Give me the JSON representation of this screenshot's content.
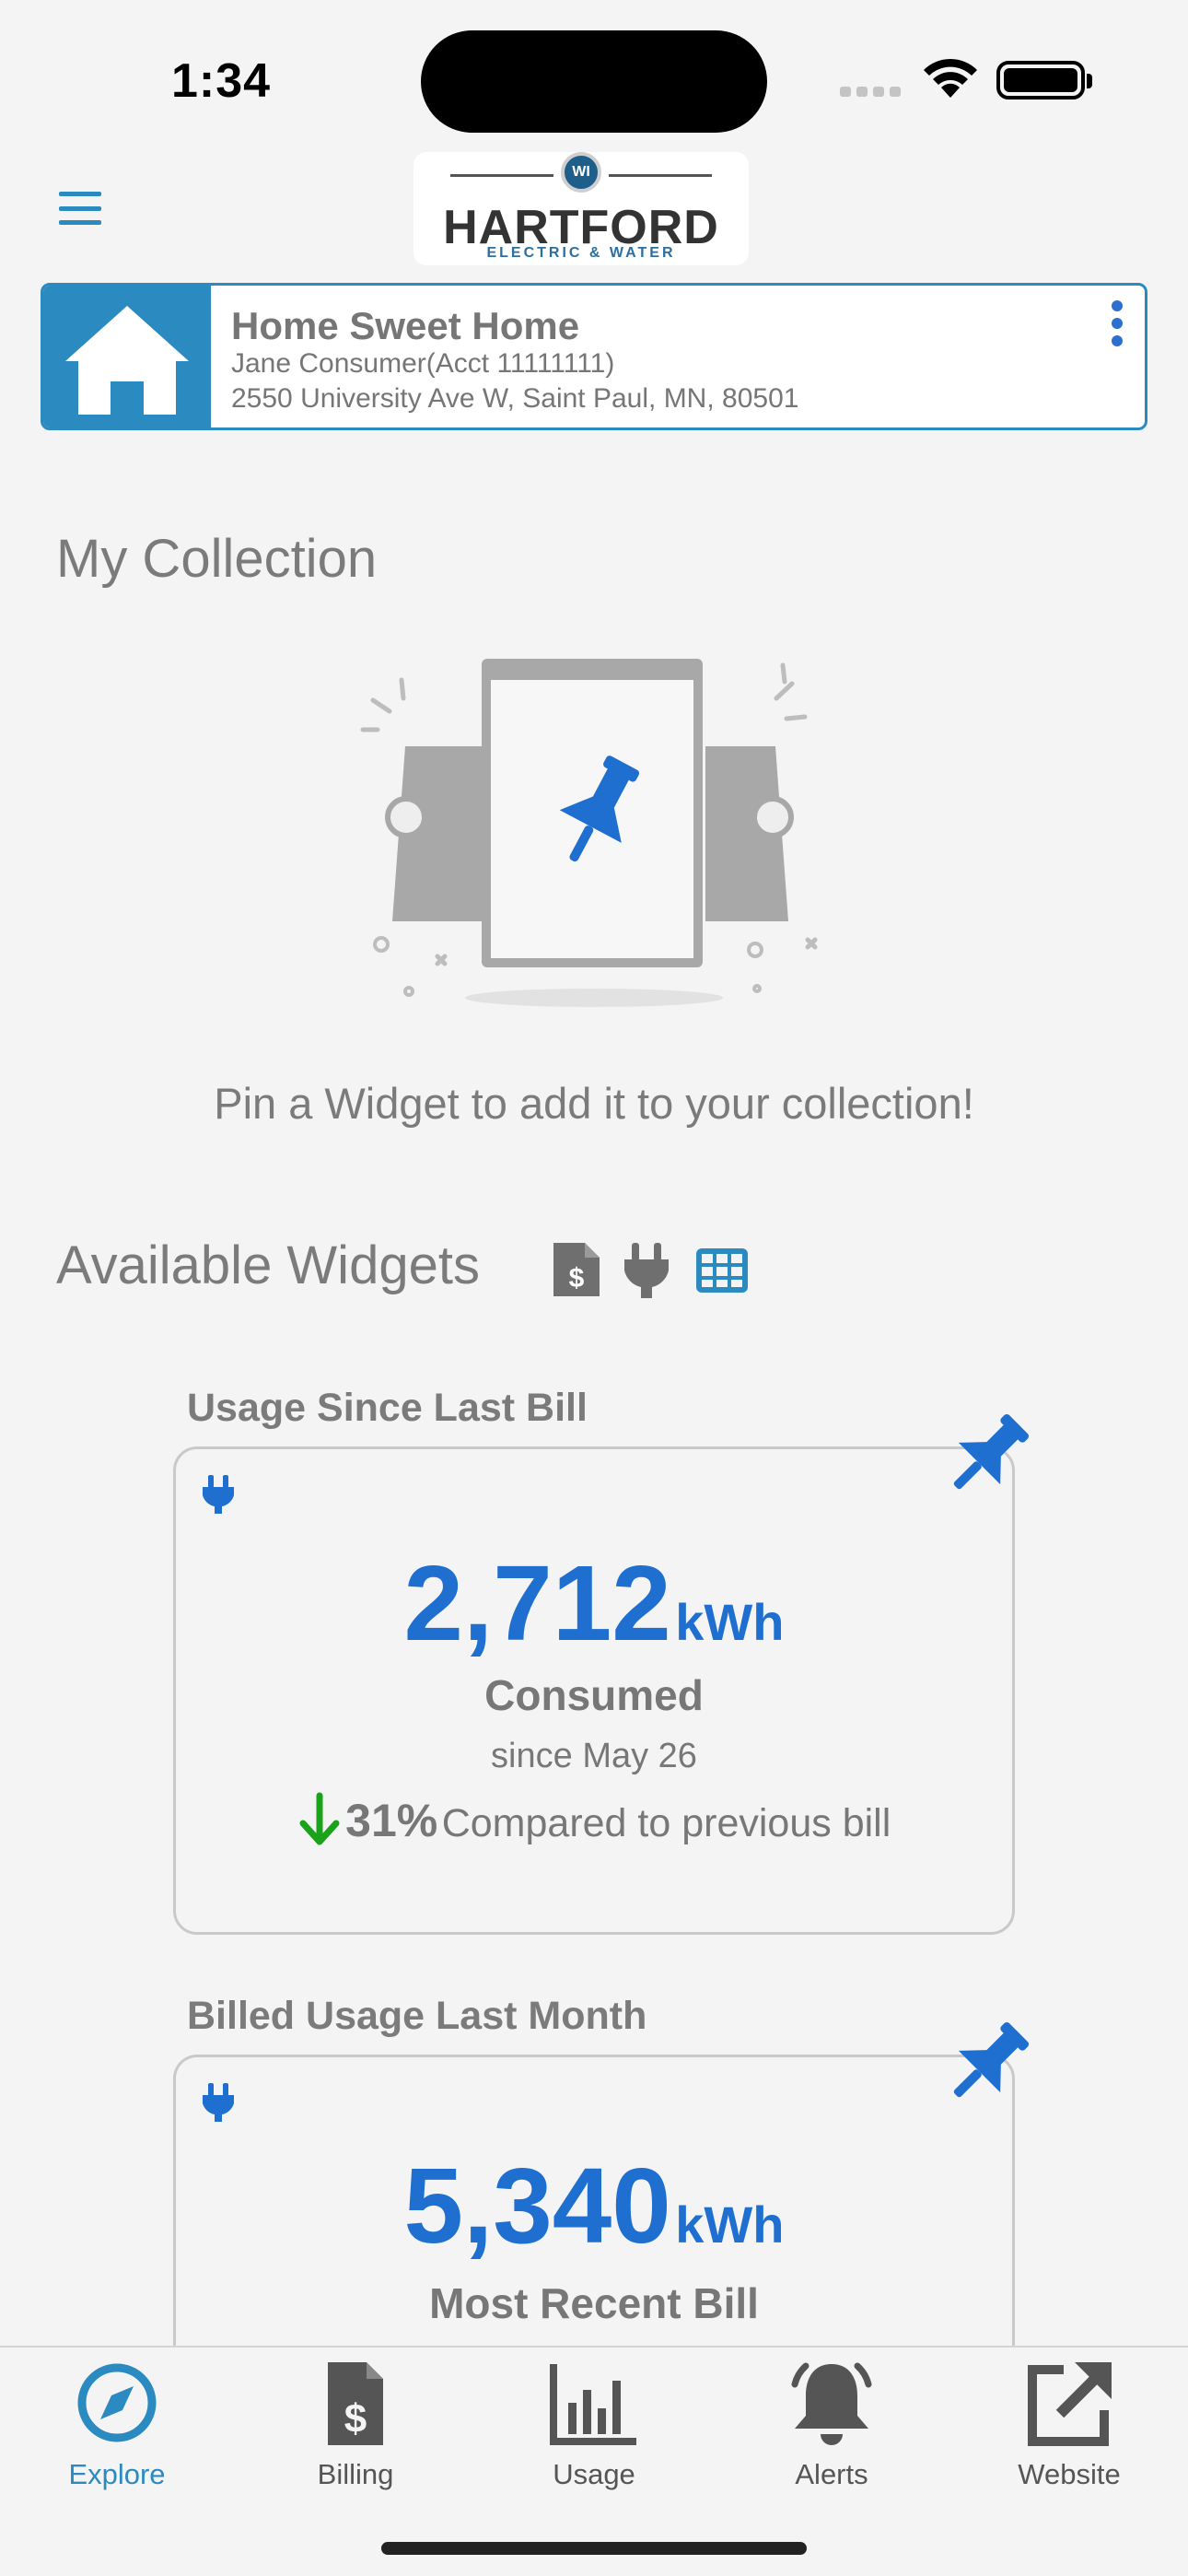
{
  "status_bar": {
    "time": "1:34"
  },
  "header": {
    "logo_badge": "WI",
    "logo_word": "HARTFORD",
    "logo_sub": "ELECTRIC & WATER"
  },
  "account": {
    "name": "Home Sweet Home",
    "holder": "Jane Consumer(Acct 11111111)",
    "address": "2550 University Ave W, Saint Paul, MN, 80501"
  },
  "collection": {
    "title": "My Collection",
    "empty_message": "Pin a Widget to add it to your collection!"
  },
  "available": {
    "title": "Available Widgets"
  },
  "widgets": [
    {
      "label": "Usage Since Last Bill",
      "value": "2,712",
      "unit": "kWh",
      "caption": "Consumed",
      "subcaption": "since May 26",
      "change_pct": "31%",
      "change_text": "Compared to previous bill"
    },
    {
      "label": "Billed Usage Last Month",
      "value": "5,340",
      "unit": "kWh",
      "caption": "Most Recent Bill"
    }
  ],
  "tabs": [
    {
      "label": "Explore",
      "icon": "compass-icon",
      "active": true
    },
    {
      "label": "Billing",
      "icon": "invoice-icon"
    },
    {
      "label": "Usage",
      "icon": "bar-chart-icon"
    },
    {
      "label": "Alerts",
      "icon": "bell-icon"
    },
    {
      "label": "Website",
      "icon": "external-link-icon"
    }
  ],
  "colors": {
    "accent": "#2b8bc1",
    "primary_blue": "#1f6fd0",
    "down_green": "#1aa31a",
    "text_gray": "#7b7b7b"
  }
}
